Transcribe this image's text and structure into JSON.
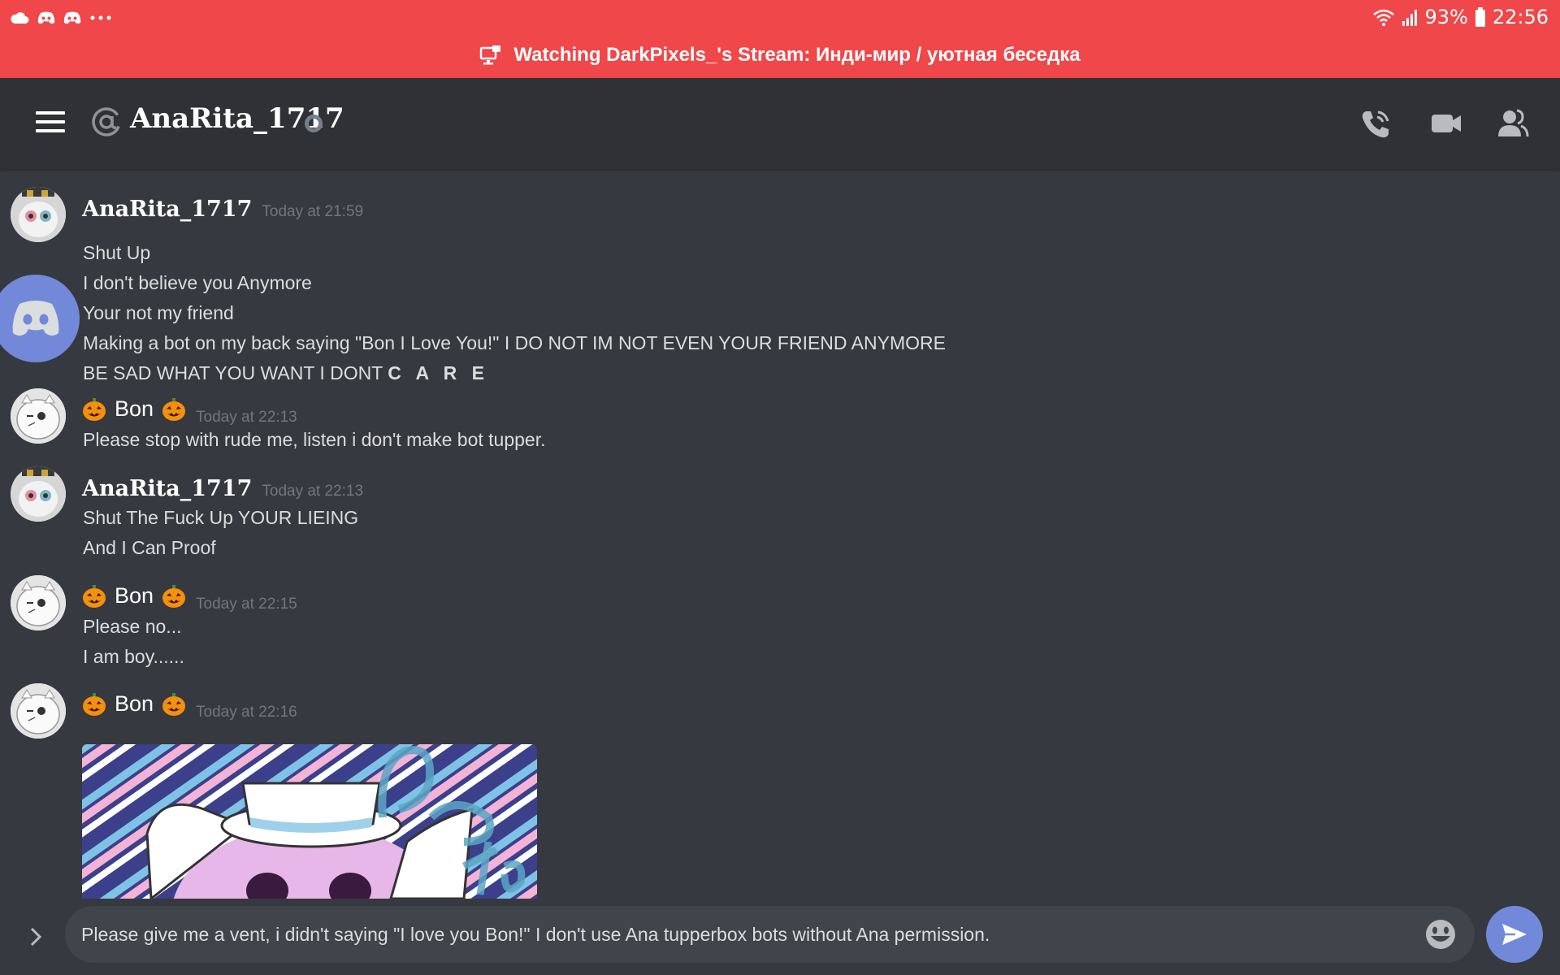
{
  "status_bar": {
    "battery": "93%",
    "time": "22:56",
    "left_icons": [
      "cloud-icon",
      "discord-icon",
      "discord-icon",
      "more-icon"
    ],
    "right_icons": [
      "wifi-icon",
      "signal-icon",
      "battery-icon"
    ]
  },
  "stream_banner": {
    "text": "Watching DarkPixels_'s Stream: Инди-мир / уютная беседка",
    "color": "#f0474a"
  },
  "header": {
    "title": "AnaRita_1717",
    "icons": [
      "menu-icon",
      "at-icon",
      "status-idle-icon",
      "call-icon",
      "video-icon",
      "members-icon"
    ]
  },
  "messages": [
    {
      "author": "AnaRita_1717",
      "timestamp": "Today at 21:59",
      "lines": [
        "Shut Up",
        "I don't believe you Anymore",
        "Your not my friend",
        "Making a bot on my back saying \"Bon I Love You!\" I DO NOT IM NOT EVEN YOUR FRIEND ANYMORE",
        "BE SAD WHAT YOU WANT I DONT",
        "C A R E"
      ]
    },
    {
      "author": "Bon",
      "timestamp": "Today at 22:13",
      "lines": [
        "Please stop with rude me, listen i don't make bot tupper."
      ]
    },
    {
      "author": "AnaRita_1717",
      "timestamp": "Today at 22:13",
      "lines": [
        "Shut The Fuck Up YOUR LIEING",
        "And I Can Proof"
      ]
    },
    {
      "author": "Bon",
      "timestamp": "Today at 22:15",
      "lines": [
        "Please no...",
        "I am boy......"
      ]
    },
    {
      "author": "Bon",
      "timestamp": "Today at 22:16",
      "lines": [],
      "attachment": "image"
    }
  ],
  "composer": {
    "value": "Please give me a vent, i didn't saying \"I love you Bon!\" I don't use Ana tupperbox bots without Ana permission."
  },
  "colors": {
    "background": "#36393f",
    "header": "#2f3136",
    "blurple": "#7289da",
    "input": "#40444b"
  }
}
